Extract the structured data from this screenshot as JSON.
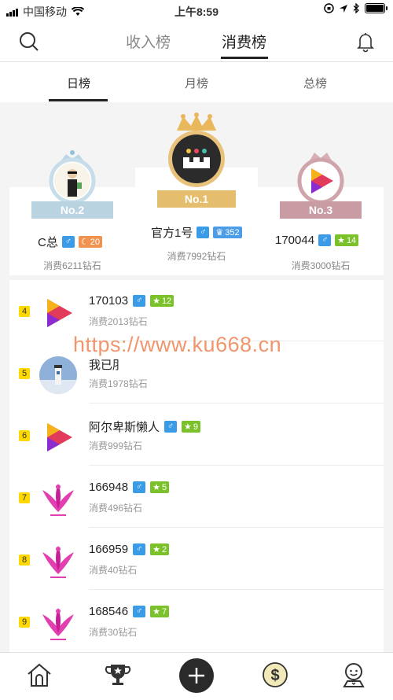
{
  "status_bar": {
    "carrier": "中国移动",
    "time": "上午8:59"
  },
  "header": {
    "tabs": [
      "收入榜",
      "消费榜"
    ],
    "active_tab": "消费榜"
  },
  "subtabs": [
    "日榜",
    "月榜",
    "总榜"
  ],
  "podium": {
    "first": {
      "badge": "No.1",
      "name": "官方1号",
      "level": "352",
      "spend": "消费7992钻石"
    },
    "second": {
      "badge": "No.2",
      "name": "C总",
      "level": "20",
      "spend": "消费6211钻石"
    },
    "third": {
      "badge": "No.3",
      "name": "170044",
      "level": "14",
      "spend": "消费3000钻石"
    }
  },
  "list": [
    {
      "rank": "4",
      "name": "170103",
      "level": "12",
      "spend": "消费2013钻石",
      "avatar": "play-logo"
    },
    {
      "rank": "5",
      "name": "我已⺼",
      "level": "",
      "spend": "消费1978钻石",
      "avatar": "lighthouse-photo"
    },
    {
      "rank": "6",
      "name": "阿尔卑斯懒人",
      "level": "9",
      "spend": "消费999钻石",
      "avatar": "play-logo"
    },
    {
      "rank": "7",
      "name": "166948",
      "level": "5",
      "spend": "消费496钻石",
      "avatar": "pink-flower"
    },
    {
      "rank": "8",
      "name": "166959",
      "level": "2",
      "spend": "消费40钻石",
      "avatar": "pink-flower"
    },
    {
      "rank": "9",
      "name": "168546",
      "level": "7",
      "spend": "消费30钻石",
      "avatar": "pink-flower"
    }
  ],
  "gender_symbol": "♂",
  "watermark": "https://www.ku668.cn",
  "colors": {
    "accent": "#222222",
    "gender": "#3a9be6",
    "level_green": "#7ac12a",
    "rank_yellow": "#ffd800"
  }
}
